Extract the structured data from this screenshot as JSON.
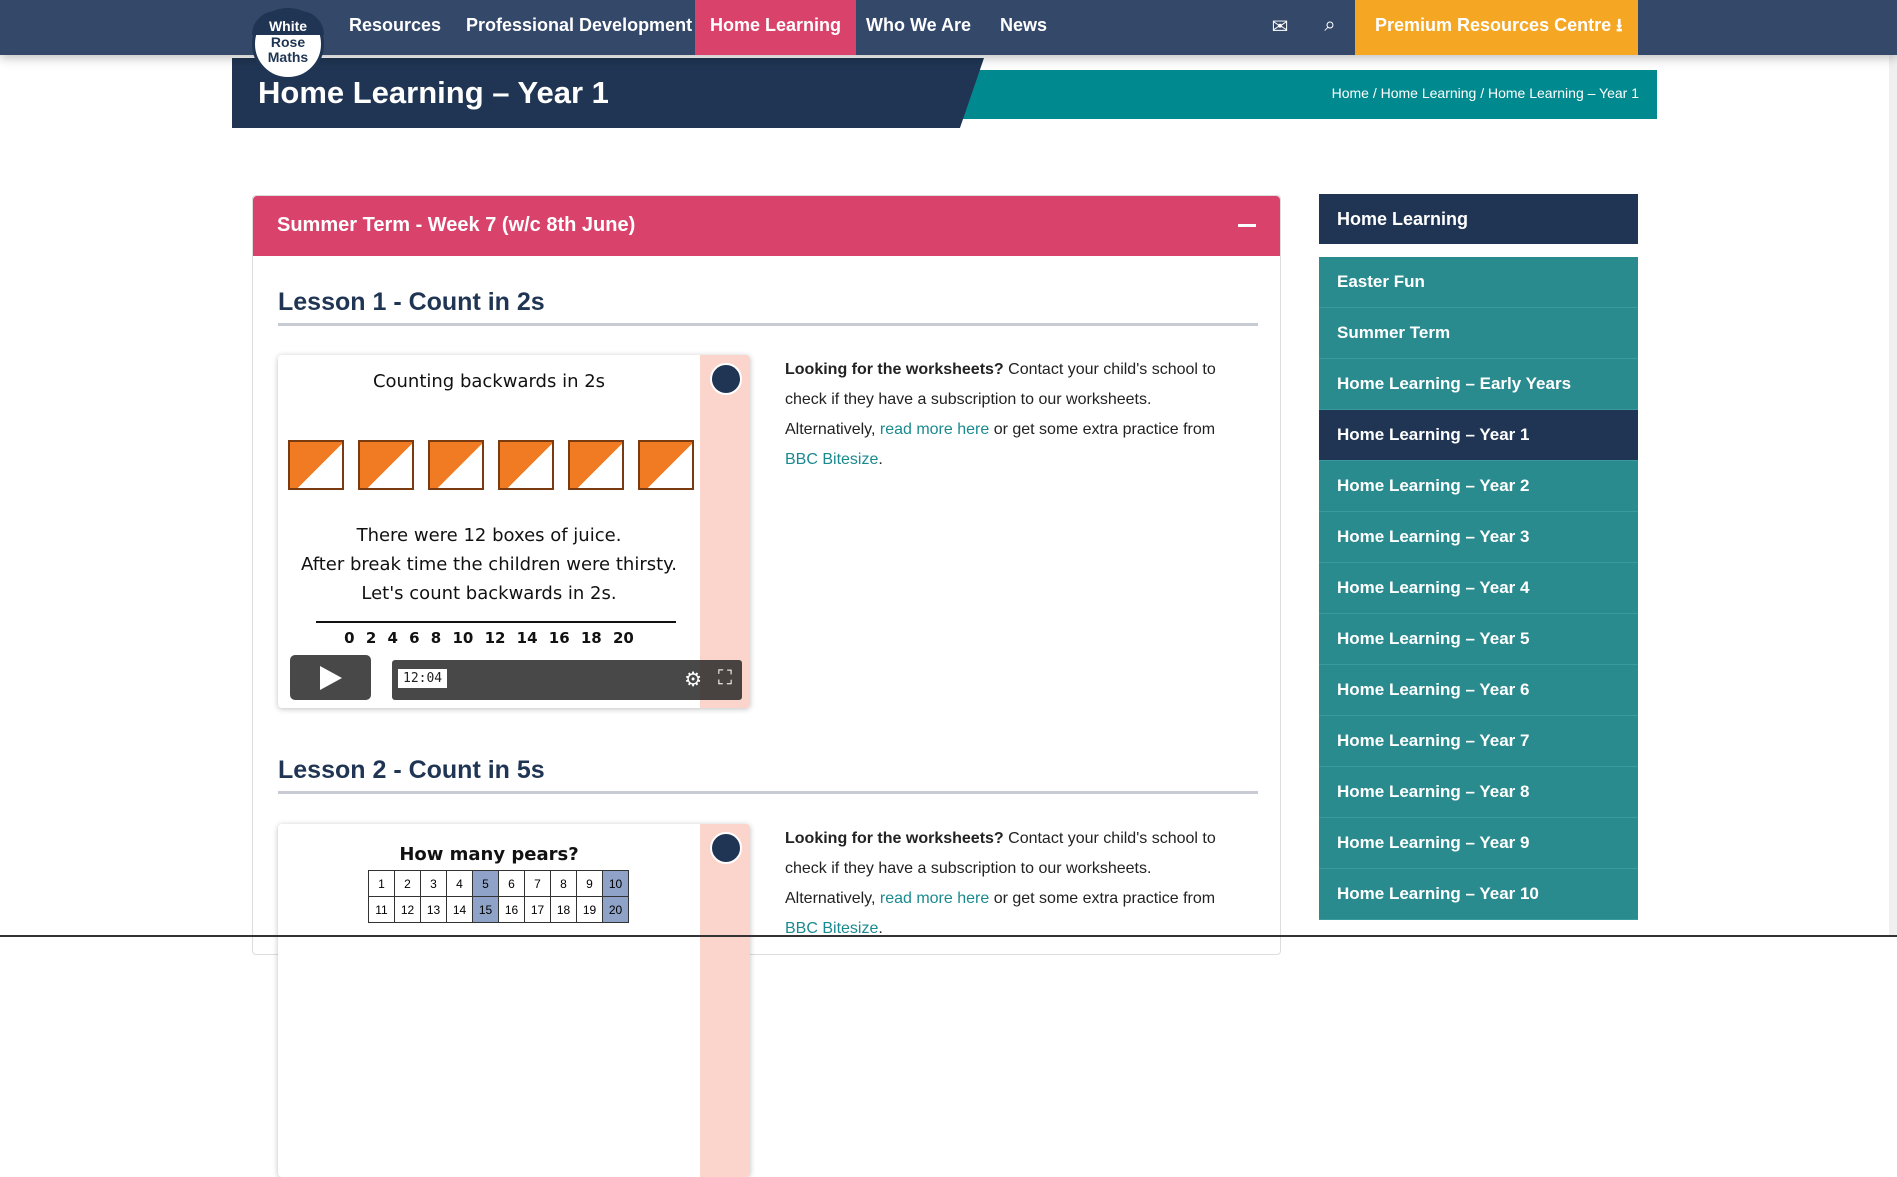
{
  "nav": {
    "logo": [
      "White",
      "Rose",
      "Maths"
    ],
    "items": [
      "Resources",
      "Professional Development",
      "Home Learning",
      "Who We Are",
      "News"
    ],
    "active": "Home Learning",
    "premium": "Premium Resources Centre"
  },
  "banner": {
    "title": "Home Learning – Year 1",
    "breadcrumb": "Home / Home Learning / Home Learning – Year 1"
  },
  "panel": {
    "title": "Summer Term - Week 7 (w/c 8th June)",
    "lessons": [
      {
        "title": "Lesson 1 - Count in 2s",
        "video": {
          "heading": "Counting backwards in 2s",
          "lines": [
            "There were 12 boxes of juice.",
            "After break time the children were thirsty.",
            "Let's count backwards in 2s."
          ],
          "numbers": "0 2 4 6 8 10 12 14 16 18 20",
          "time": "12:04"
        }
      },
      {
        "title": "Lesson 2 - Count in 5s",
        "video": {
          "heading": "How many pears?"
        }
      }
    ],
    "desc": {
      "bold": "Looking for the worksheets?",
      "text1": " Contact your child's school to check if they have a subscription to our worksheets. Alternatively, ",
      "link1": "read more here",
      "text2": " or get some extra practice from ",
      "link2": "BBC Bitesize",
      "text3": "."
    }
  },
  "sidebar": {
    "title": "Home Learning",
    "items": [
      "Easter Fun",
      "Summer Term",
      "Home Learning – Early Years",
      "Home Learning – Year 1",
      "Home Learning – Year 2",
      "Home Learning – Year 3",
      "Home Learning – Year 4",
      "Home Learning – Year 5",
      "Home Learning – Year 6",
      "Home Learning – Year 7",
      "Home Learning – Year 8",
      "Home Learning – Year 9",
      "Home Learning – Year 10"
    ],
    "active": "Home Learning – Year 1"
  },
  "colors": {
    "nav": "#34486a",
    "accent": "#d9436b",
    "dark": "#1f3553",
    "teal": "#2a8b8f",
    "premium": "#f5a623"
  }
}
